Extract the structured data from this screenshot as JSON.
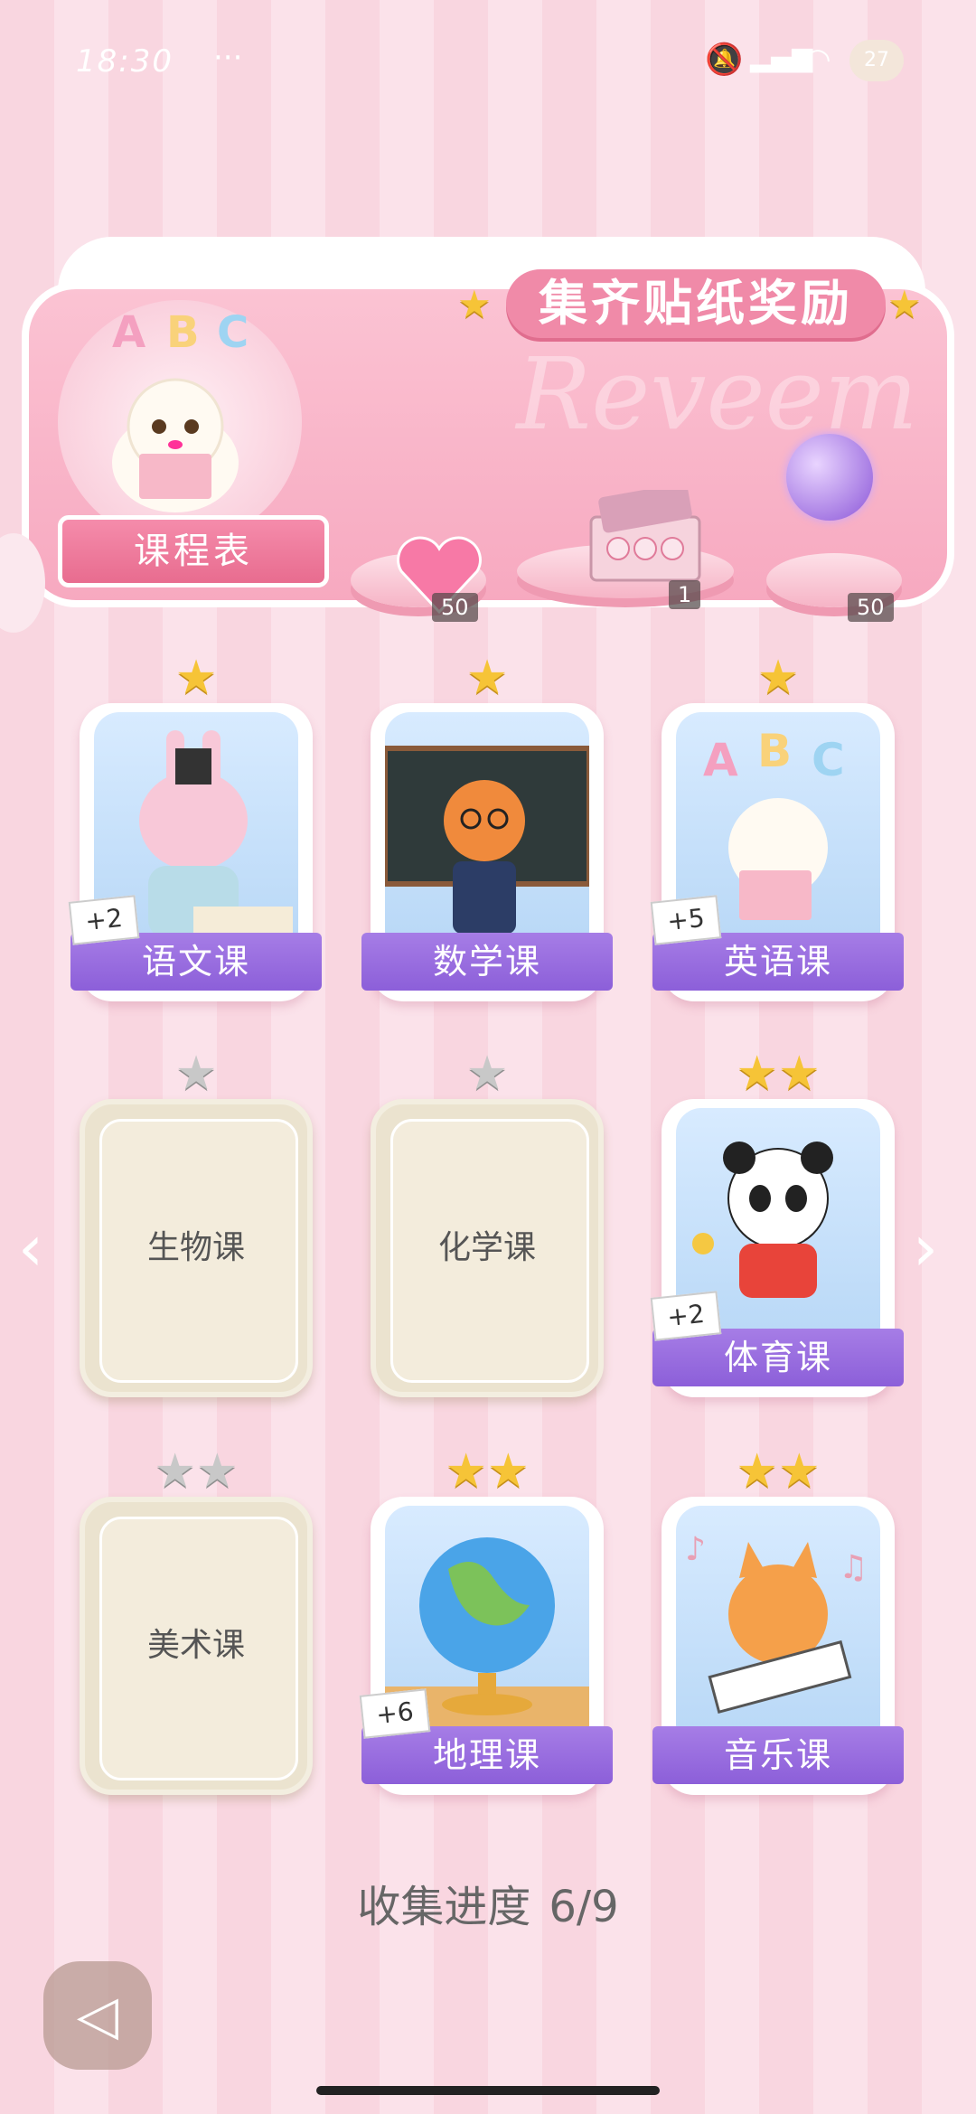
{
  "status_bar": {
    "time": "18:30",
    "dots": "···",
    "battery": "27"
  },
  "banner": {
    "title": "集齐贴纸奖励",
    "schedule_label": "课程表",
    "rewards": [
      {
        "name": "heart-gem",
        "count": "50"
      },
      {
        "name": "gift-box",
        "count": "1"
      },
      {
        "name": "energy-orb",
        "count": "50"
      }
    ],
    "watermark": "Reveem"
  },
  "cards": [
    {
      "label": "语文课",
      "stars": 1,
      "locked": false,
      "plus": "+2"
    },
    {
      "label": "数学课",
      "stars": 1,
      "locked": false,
      "plus": ""
    },
    {
      "label": "英语课",
      "stars": 1,
      "locked": false,
      "plus": "+5"
    },
    {
      "label": "生物课",
      "stars": 1,
      "locked": true,
      "plus": ""
    },
    {
      "label": "化学课",
      "stars": 1,
      "locked": true,
      "plus": ""
    },
    {
      "label": "体育课",
      "stars": 2,
      "locked": false,
      "plus": "+2"
    },
    {
      "label": "美术课",
      "stars": 2,
      "locked": true,
      "plus": ""
    },
    {
      "label": "地理课",
      "stars": 2,
      "locked": false,
      "plus": "+6"
    },
    {
      "label": "音乐课",
      "stars": 2,
      "locked": false,
      "plus": ""
    }
  ],
  "progress": {
    "label": "收集进度",
    "value": "6/9"
  }
}
